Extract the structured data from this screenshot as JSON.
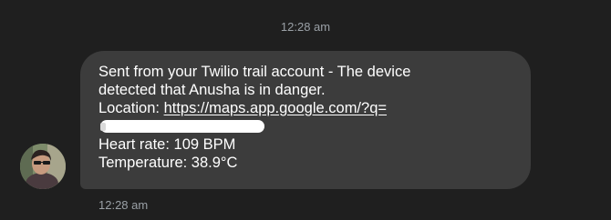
{
  "conversation": {
    "divider_time": "12:28 am",
    "message": {
      "line1": "Sent from your Twilio trail account -  The device",
      "line2": "detected that Anusha is in danger.",
      "location_label": "Location: ",
      "location_url": "https://maps.app.google.com/?q=",
      "heart_rate": "Heart rate: 109 BPM",
      "temperature": "Temperature: 38.9°C"
    },
    "message_time": "12:28 am"
  },
  "colors": {
    "background": "#1f1f1f",
    "bubble": "#3c3c3c",
    "muted_text": "#9aa0a6",
    "text": "#ffffff"
  },
  "icons": {
    "avatar": "contact-avatar"
  }
}
